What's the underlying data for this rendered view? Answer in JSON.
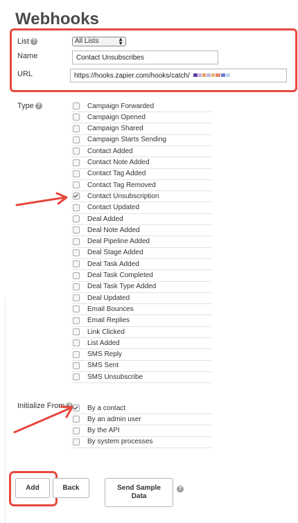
{
  "page": {
    "title": "Webhooks"
  },
  "form": {
    "list_label": "List",
    "list_value": "All Lists",
    "name_label": "Name",
    "name_value": "Contact Unsubscribes",
    "url_label": "URL",
    "url_value": "https://hooks.zapier.com/hooks/catch/"
  },
  "type": {
    "label": "Type",
    "options": [
      {
        "label": "Campaign Forwarded",
        "checked": false
      },
      {
        "label": "Campaign Opened",
        "checked": false
      },
      {
        "label": "Campaign Shared",
        "checked": false
      },
      {
        "label": "Campaign Starts Sending",
        "checked": false
      },
      {
        "label": "Contact Added",
        "checked": false
      },
      {
        "label": "Contact Note Added",
        "checked": false
      },
      {
        "label": "Contact Tag Added",
        "checked": false
      },
      {
        "label": "Contact Tag Removed",
        "checked": false
      },
      {
        "label": "Contact Unsubscription",
        "checked": true
      },
      {
        "label": "Contact Updated",
        "checked": false
      },
      {
        "label": "Deal Added",
        "checked": false
      },
      {
        "label": "Deal Note Added",
        "checked": false
      },
      {
        "label": "Deal Pipeline Added",
        "checked": false
      },
      {
        "label": "Deal Stage Added",
        "checked": false
      },
      {
        "label": "Deal Task Added",
        "checked": false
      },
      {
        "label": "Deal Task Completed",
        "checked": false
      },
      {
        "label": "Deal Task Type Added",
        "checked": false
      },
      {
        "label": "Deal Updated",
        "checked": false
      },
      {
        "label": "Email Bounces",
        "checked": false
      },
      {
        "label": "Email Replies",
        "checked": false
      },
      {
        "label": "Link Clicked",
        "checked": false
      },
      {
        "label": "List Added",
        "checked": false
      },
      {
        "label": "SMS Reply",
        "checked": false
      },
      {
        "label": "SMS Sent",
        "checked": false
      },
      {
        "label": "SMS Unsubscribe",
        "checked": false
      }
    ]
  },
  "initialize": {
    "label": "Initialize From",
    "options": [
      {
        "label": "By a contact",
        "checked": true
      },
      {
        "label": "By an admin user",
        "checked": false
      },
      {
        "label": "By the API",
        "checked": false
      },
      {
        "label": "By system processes",
        "checked": false
      }
    ]
  },
  "buttons": {
    "add": "Add",
    "back": "Back",
    "send_sample_line1": "Send Sample",
    "send_sample_line2": "Data"
  },
  "help_glyph": "?",
  "annotation_color": "#e8473d"
}
